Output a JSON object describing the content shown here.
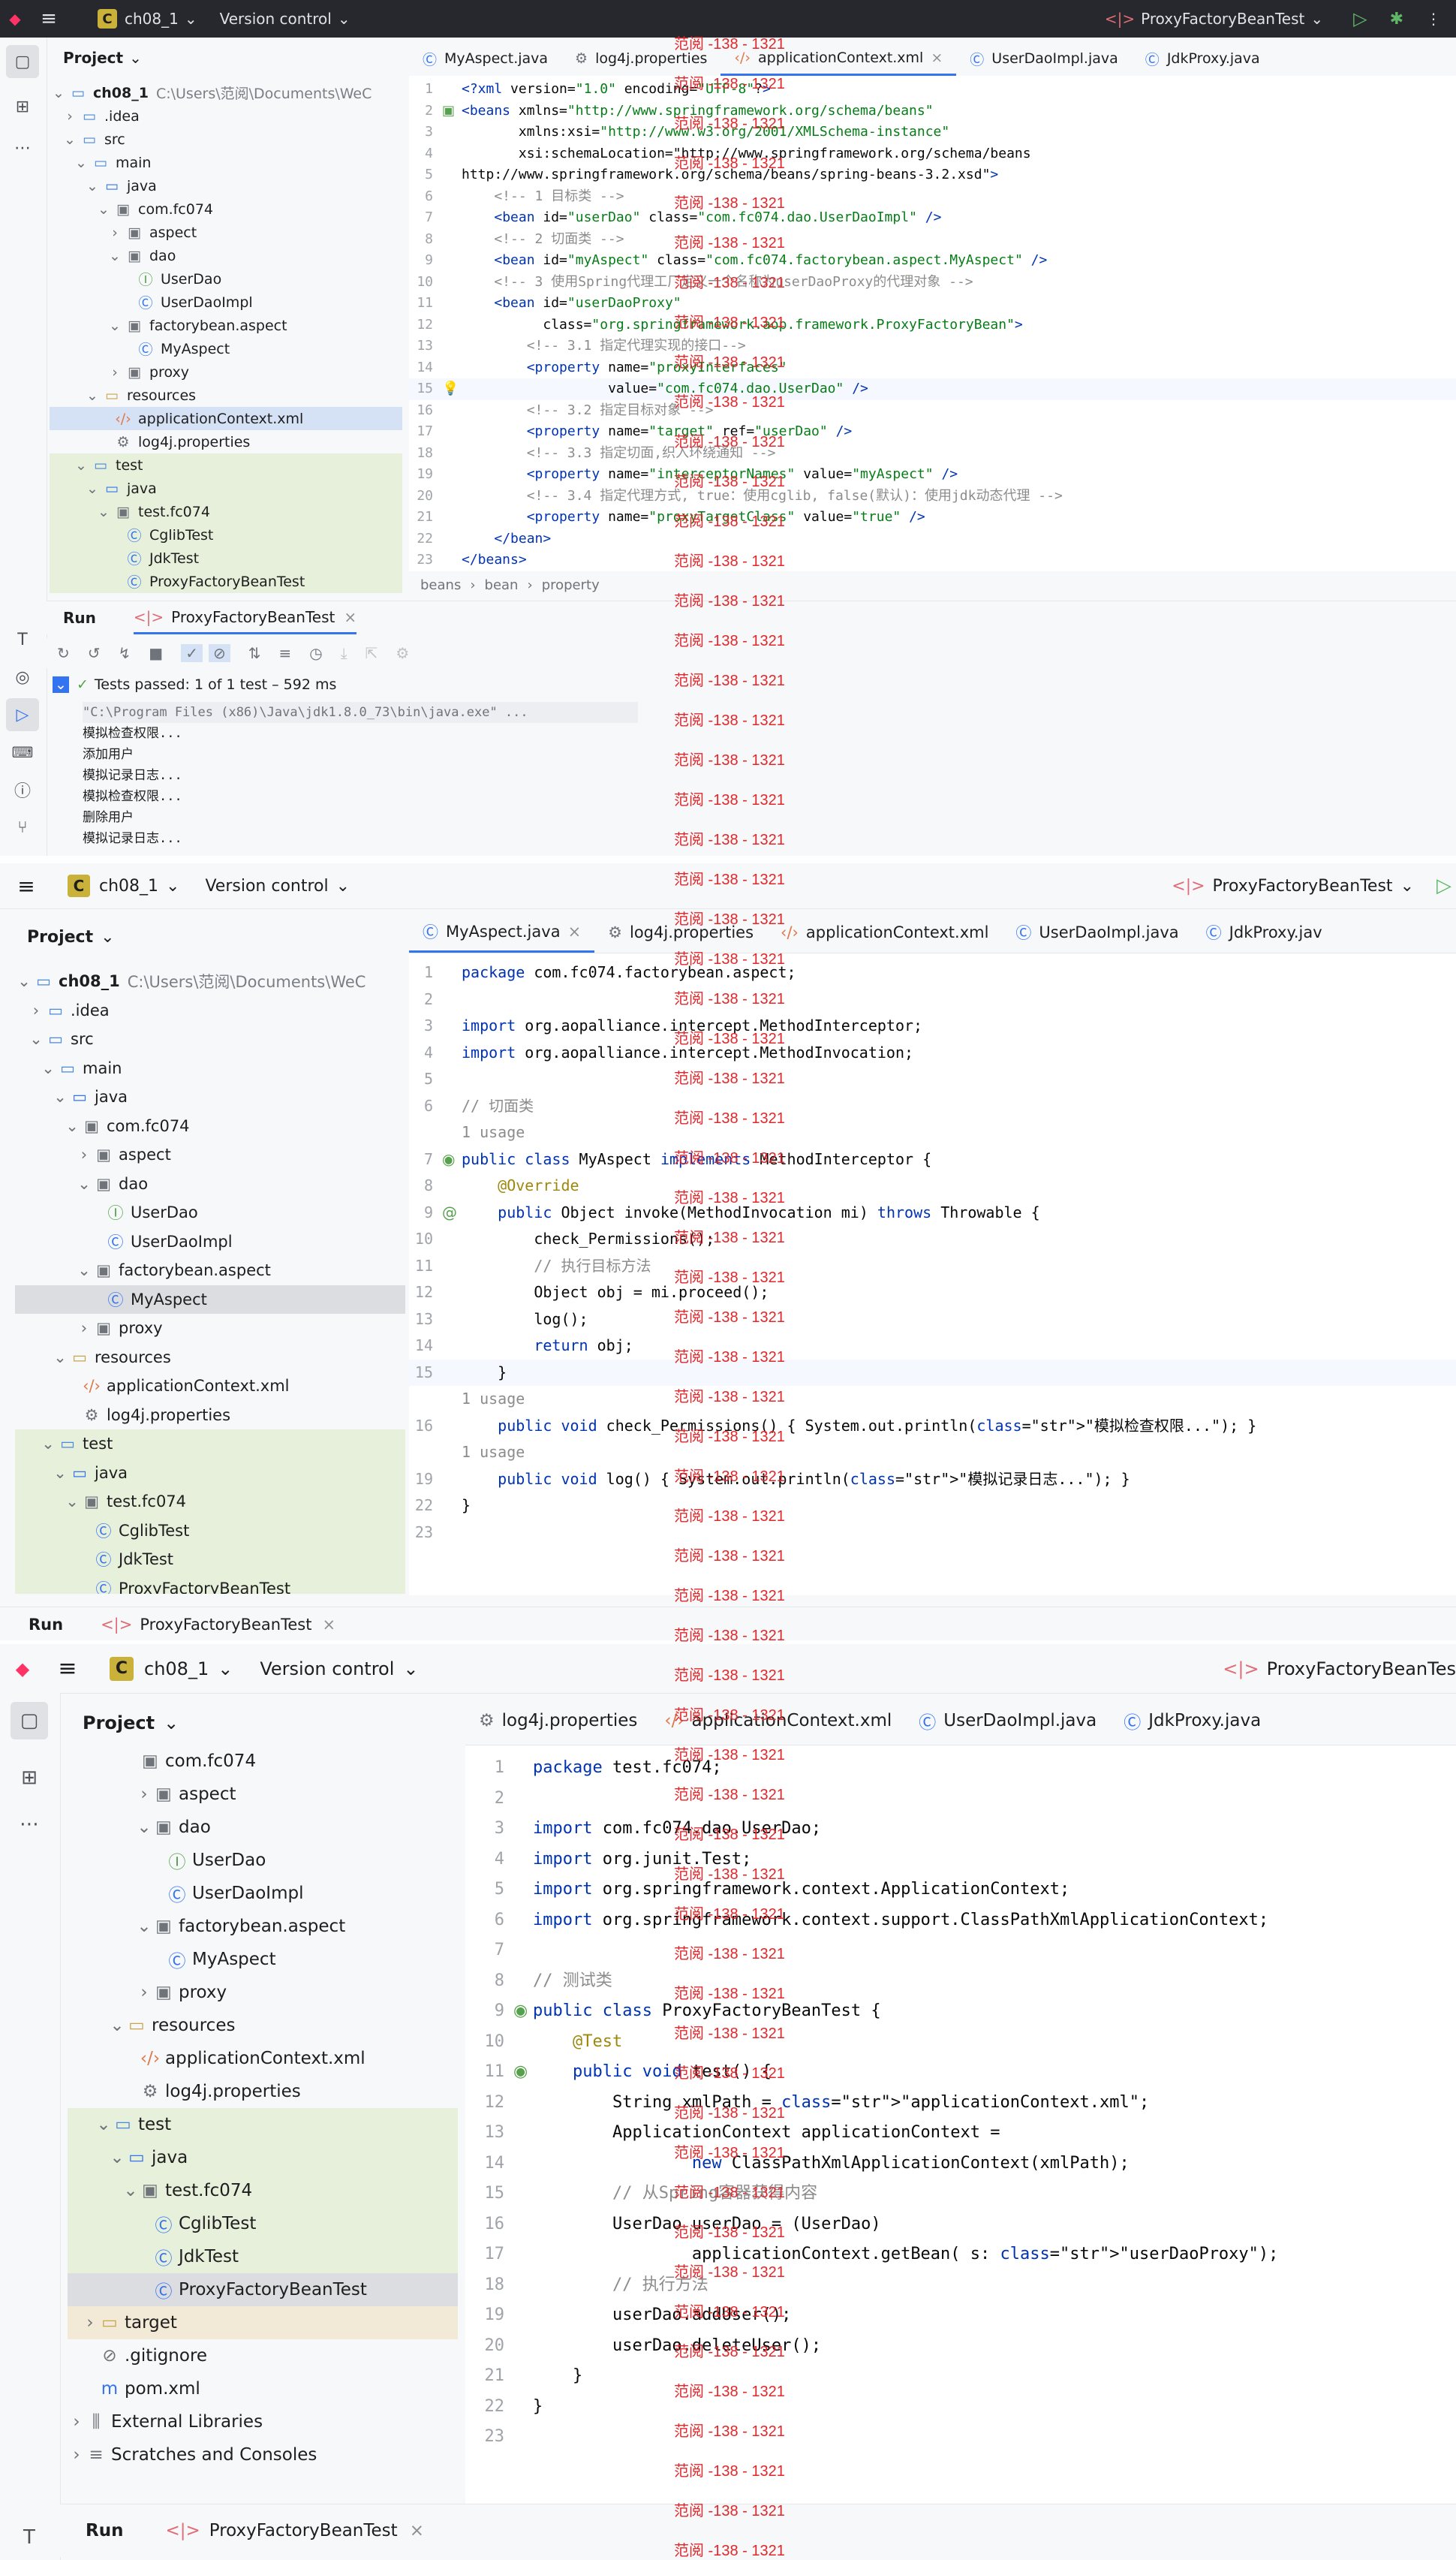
{
  "panel1": {
    "project_name": "ch08_1",
    "vcs": "Version control",
    "run_config": "ProxyFactoryBeanTest",
    "project_label": "Project",
    "tabs": [
      "MyAspect.java",
      "log4j.properties",
      "applicationContext.xml",
      "UserDaoImpl.java",
      "JdkProxy.java"
    ],
    "tree": [
      {
        "text": "ch08_1",
        "hint": "C:\\Users\\范阅\\Documents\\WeC",
        "icon": "folder",
        "bold": true
      },
      {
        "text": ".idea",
        "icon": "folder"
      },
      {
        "text": "src",
        "icon": "folder"
      },
      {
        "text": "main",
        "icon": "folder"
      },
      {
        "text": "java",
        "icon": "folder-java"
      },
      {
        "text": "com.fc074",
        "icon": "package"
      },
      {
        "text": "aspect",
        "icon": "package"
      },
      {
        "text": "dao",
        "icon": "package"
      },
      {
        "text": "UserDao",
        "icon": "interface"
      },
      {
        "text": "UserDaoImpl",
        "icon": "class"
      },
      {
        "text": "factorybean.aspect",
        "icon": "package"
      },
      {
        "text": "MyAspect",
        "icon": "class"
      },
      {
        "text": "proxy",
        "icon": "package"
      },
      {
        "text": "resources",
        "icon": "folder-res"
      },
      {
        "text": "applicationContext.xml",
        "icon": "xml"
      },
      {
        "text": "log4j.properties",
        "icon": "props"
      },
      {
        "text": "test",
        "icon": "folder"
      },
      {
        "text": "java",
        "icon": "folder-java"
      },
      {
        "text": "test.fc074",
        "icon": "package"
      },
      {
        "text": "CglibTest",
        "icon": "class"
      },
      {
        "text": "JdkTest",
        "icon": "class"
      },
      {
        "text": "ProxyFactoryBeanTest",
        "icon": "class"
      }
    ],
    "code": [
      "<?xml version=\"1.0\" encoding=\"UTF-8\"?>",
      "<beans xmlns=\"http://www.springframework.org/schema/beans\"",
      "       xmlns:xsi=\"http://www.w3.org/2001/XMLSchema-instance\"",
      "       xsi:schemaLocation=\"http://www.springframework.org/schema/beans",
      "http://www.springframework.org/schema/beans/spring-beans-3.2.xsd\">",
      "    <!-- 1 目标类 -->",
      "    <bean id=\"userDao\" class=\"com.fc074.dao.UserDaoImpl\" />",
      "    <!-- 2 切面类 -->",
      "    <bean id=\"myAspect\" class=\"com.fc074.factorybean.aspect.MyAspect\" />",
      "    <!-- 3 使用Spring代理工厂定义一个名称为userDaoProxy的代理对象 -->",
      "    <bean id=\"userDaoProxy\"",
      "          class=\"org.springframework.aop.framework.ProxyFactoryBean\">",
      "        <!-- 3.1 指定代理实现的接口-->",
      "        <property name=\"proxyInterfaces\"",
      "                  value=\"com.fc074.dao.UserDao\" />",
      "        <!-- 3.2 指定目标对象 -->",
      "        <property name=\"target\" ref=\"userDao\" />",
      "        <!-- 3.3 指定切面,织入环绕通知 -->",
      "        <property name=\"interceptorNames\" value=\"myAspect\" />",
      "        <!-- 3.4 指定代理方式, true：使用cglib, false(默认)：使用jdk动态代理 -->",
      "        <property name=\"proxyTargetClass\" value=\"true\" />",
      "    </bean>",
      "</beans>"
    ],
    "breadcrumb": [
      "beans",
      "bean",
      "property"
    ],
    "run_label": "Run",
    "run_tab": "ProxyFactoryBeanTest",
    "tests_passed": "Tests passed: 1 of 1 test – 592 ms",
    "console": [
      "\"C:\\Program Files (x86)\\Java\\jdk1.8.0_73\\bin\\java.exe\" ...",
      "模拟检查权限...",
      "添加用户",
      "模拟记录日志...",
      "模拟检查权限...",
      "删除用户",
      "模拟记录日志..."
    ]
  },
  "panel2": {
    "project_name": "ch08_1",
    "vcs": "Version control",
    "run_config": "ProxyFactoryBeanTest",
    "project_label": "Project",
    "tabs": [
      "MyAspect.java",
      "log4j.properties",
      "applicationContext.xml",
      "UserDaoImpl.java",
      "JdkProxy.jav"
    ],
    "tree": [
      {
        "text": "ch08_1",
        "hint": "C:\\Users\\范阅\\Documents\\WeC",
        "icon": "folder",
        "bold": true
      },
      {
        "text": ".idea",
        "icon": "folder"
      },
      {
        "text": "src",
        "icon": "folder"
      },
      {
        "text": "main",
        "icon": "folder"
      },
      {
        "text": "java",
        "icon": "folder-java"
      },
      {
        "text": "com.fc074",
        "icon": "package"
      },
      {
        "text": "aspect",
        "icon": "package"
      },
      {
        "text": "dao",
        "icon": "package"
      },
      {
        "text": "UserDao",
        "icon": "interface"
      },
      {
        "text": "UserDaoImpl",
        "icon": "class"
      },
      {
        "text": "factorybean.aspect",
        "icon": "package"
      },
      {
        "text": "MyAspect",
        "icon": "class"
      },
      {
        "text": "proxy",
        "icon": "package"
      },
      {
        "text": "resources",
        "icon": "folder-res"
      },
      {
        "text": "applicationContext.xml",
        "icon": "xml"
      },
      {
        "text": "log4j.properties",
        "icon": "props"
      },
      {
        "text": "test",
        "icon": "folder"
      },
      {
        "text": "java",
        "icon": "folder-java"
      },
      {
        "text": "test.fc074",
        "icon": "package"
      },
      {
        "text": "CglibTest",
        "icon": "class"
      },
      {
        "text": "JdkTest",
        "icon": "class"
      },
      {
        "text": "ProxyFactoryBeanTest",
        "icon": "class"
      }
    ],
    "lines": [
      {
        "n": "1",
        "t": "package com.fc074.factorybean.aspect;"
      },
      {
        "n": "2",
        "t": ""
      },
      {
        "n": "3",
        "t": "import org.aopalliance.intercept.MethodInterceptor;"
      },
      {
        "n": "4",
        "t": "import org.aopalliance.intercept.MethodInvocation;"
      },
      {
        "n": "5",
        "t": ""
      },
      {
        "n": "6",
        "t": "// 切面类"
      },
      {
        "n": "",
        "t": "1 usage"
      },
      {
        "n": "7",
        "t": "public class MyAspect implements MethodInterceptor {"
      },
      {
        "n": "8",
        "t": "    @Override"
      },
      {
        "n": "9",
        "t": "    public Object invoke(MethodInvocation mi) throws Throwable {"
      },
      {
        "n": "10",
        "t": "        check_Permissions();"
      },
      {
        "n": "11",
        "t": "        // 执行目标方法"
      },
      {
        "n": "12",
        "t": "        Object obj = mi.proceed();"
      },
      {
        "n": "13",
        "t": "        log();"
      },
      {
        "n": "14",
        "t": "        return obj;"
      },
      {
        "n": "15",
        "t": "    }"
      },
      {
        "n": "",
        "t": "1 usage"
      },
      {
        "n": "16",
        "t": "    public void check_Permissions() { System.out.println(\"模拟检查权限...\"); }"
      },
      {
        "n": "",
        "t": "1 usage"
      },
      {
        "n": "19",
        "t": "    public void log() { System.out.println(\"模拟记录日志...\"); }"
      },
      {
        "n": "22",
        "t": "}"
      },
      {
        "n": "23",
        "t": ""
      }
    ],
    "run_label": "Run",
    "run_tab": "ProxyFactoryBeanTest"
  },
  "panel3": {
    "project_name": "ch08_1",
    "vcs": "Version control",
    "run_config": "ProxyFactoryBeanTes",
    "project_label": "Project",
    "tabs": [
      "log4j.properties",
      "applicationContext.xml",
      "UserDaoImpl.java",
      "JdkProxy.java"
    ],
    "tree": [
      {
        "text": "com.fc074",
        "icon": "package"
      },
      {
        "text": "aspect",
        "icon": "package"
      },
      {
        "text": "dao",
        "icon": "package"
      },
      {
        "text": "UserDao",
        "icon": "interface"
      },
      {
        "text": "UserDaoImpl",
        "icon": "class"
      },
      {
        "text": "factorybean.aspect",
        "icon": "package"
      },
      {
        "text": "MyAspect",
        "icon": "class"
      },
      {
        "text": "proxy",
        "icon": "package"
      },
      {
        "text": "resources",
        "icon": "folder-res"
      },
      {
        "text": "applicationContext.xml",
        "icon": "xml"
      },
      {
        "text": "log4j.properties",
        "icon": "props"
      },
      {
        "text": "test",
        "icon": "folder"
      },
      {
        "text": "java",
        "icon": "folder-java"
      },
      {
        "text": "test.fc074",
        "icon": "package"
      },
      {
        "text": "CglibTest",
        "icon": "class"
      },
      {
        "text": "JdkTest",
        "icon": "class"
      },
      {
        "text": "ProxyFactoryBeanTest",
        "icon": "class"
      },
      {
        "text": "target",
        "icon": "folder-target"
      },
      {
        "text": ".gitignore",
        "icon": "ignore"
      },
      {
        "text": "pom.xml",
        "icon": "maven"
      },
      {
        "text": "External Libraries",
        "icon": "lib"
      },
      {
        "text": "Scratches and Consoles",
        "icon": "scratch"
      }
    ],
    "code": [
      "package test.fc074;",
      "",
      "import com.fc074.dao.UserDao;",
      "import org.junit.Test;",
      "import org.springframework.context.ApplicationContext;",
      "import org.springframework.context.support.ClassPathXmlApplicationContext;",
      "",
      "// 测试类",
      "public class ProxyFactoryBeanTest {",
      "    @Test",
      "    public void test() {",
      "        String xmlPath = \"applicationContext.xml\";",
      "        ApplicationContext applicationContext =",
      "                new ClassPathXmlApplicationContext(xmlPath);",
      "        // 从Spring容器获得内容",
      "        UserDao userDao = (UserDao)",
      "                applicationContext.getBean( s: \"userDaoProxy\");",
      "        // 执行方法",
      "        userDao.addUser();",
      "        userDao.deleteUser();",
      "    }",
      "}",
      ""
    ],
    "run_label": "Run",
    "run_tab": "ProxyFactoryBeanTest"
  },
  "watermark": "范阅 -138 - 1321"
}
